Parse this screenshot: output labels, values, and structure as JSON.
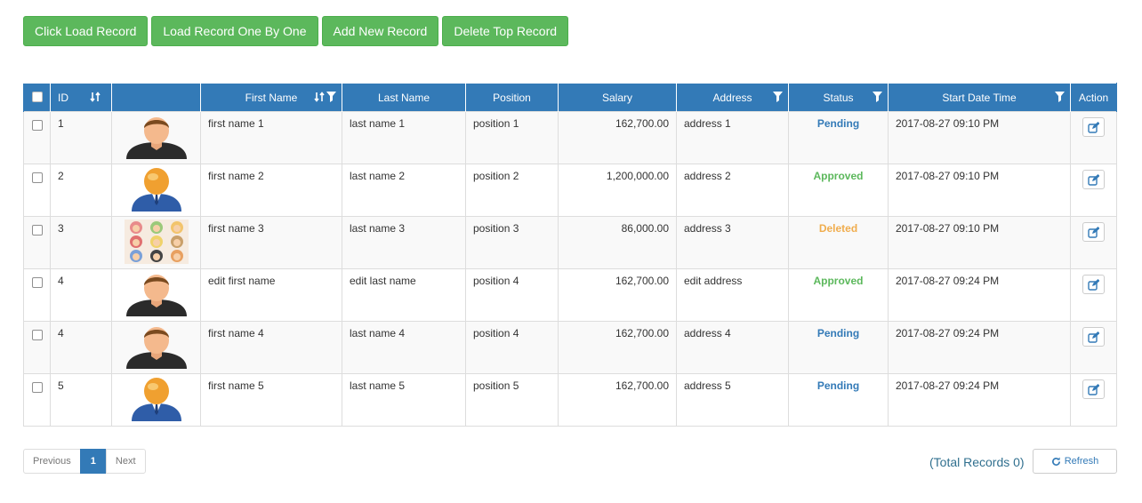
{
  "toolbar": {
    "buttons": [
      "Click Load Record",
      "Load Record One By One",
      "Add New Record",
      "Delete Top Record"
    ]
  },
  "table": {
    "headers": {
      "id": "ID",
      "first_name": "First Name",
      "last_name": "Last Name",
      "position": "Position",
      "salary": "Salary",
      "address": "Address",
      "status": "Status",
      "start_date_time": "Start Date Time",
      "action": "Action"
    },
    "rows": [
      {
        "id": "1",
        "avatar": "man-avatar",
        "first_name": "first name 1",
        "last_name": "last name 1",
        "position": "position 1",
        "salary": "162,700.00",
        "address": "address 1",
        "status": "Pending",
        "status_color": "#337ab7",
        "start": "2017-08-27 09:10 PM"
      },
      {
        "id": "2",
        "avatar": "businessman-avatar",
        "first_name": "first name 2",
        "last_name": "last name 2",
        "position": "position 2",
        "salary": "1,200,000.00",
        "address": "address 2",
        "status": "Approved",
        "status_color": "#5cb85c",
        "start": "2017-08-27 09:10 PM"
      },
      {
        "id": "3",
        "avatar": "group-faces-avatar",
        "first_name": "first name 3",
        "last_name": "last name 3",
        "position": "position 3",
        "salary": "86,000.00",
        "address": "address 3",
        "status": "Deleted",
        "status_color": "#f0ad4e",
        "start": "2017-08-27 09:10 PM"
      },
      {
        "id": "4",
        "avatar": "man-avatar",
        "first_name": "edit first name",
        "last_name": "edit last name",
        "position": "position 4",
        "salary": "162,700.00",
        "address": "edit address",
        "status": "Approved",
        "status_color": "#5cb85c",
        "start": "2017-08-27 09:24 PM"
      },
      {
        "id": "4",
        "avatar": "man-avatar",
        "first_name": "first name 4",
        "last_name": "last name 4",
        "position": "position 4",
        "salary": "162,700.00",
        "address": "address 4",
        "status": "Pending",
        "status_color": "#337ab7",
        "start": "2017-08-27 09:24 PM"
      },
      {
        "id": "5",
        "avatar": "businessman-avatar",
        "first_name": "first name 5",
        "last_name": "last name 5",
        "position": "position 5",
        "salary": "162,700.00",
        "address": "address 5",
        "status": "Pending",
        "status_color": "#337ab7",
        "start": "2017-08-27 09:24 PM"
      }
    ]
  },
  "pagination": {
    "previous": "Previous",
    "current_page": "1",
    "next": "Next"
  },
  "footer": {
    "total_records": "(Total Records 0)",
    "refresh_label": "Refresh"
  },
  "colors": {
    "header_bg": "#337ab7",
    "button_green": "#5cb85c",
    "pending": "#337ab7",
    "approved": "#5cb85c",
    "deleted": "#f0ad4e"
  },
  "icons": {
    "sort": "sort-icon",
    "filter": "filter-icon",
    "edit": "edit-icon",
    "refresh": "refresh-icon"
  }
}
